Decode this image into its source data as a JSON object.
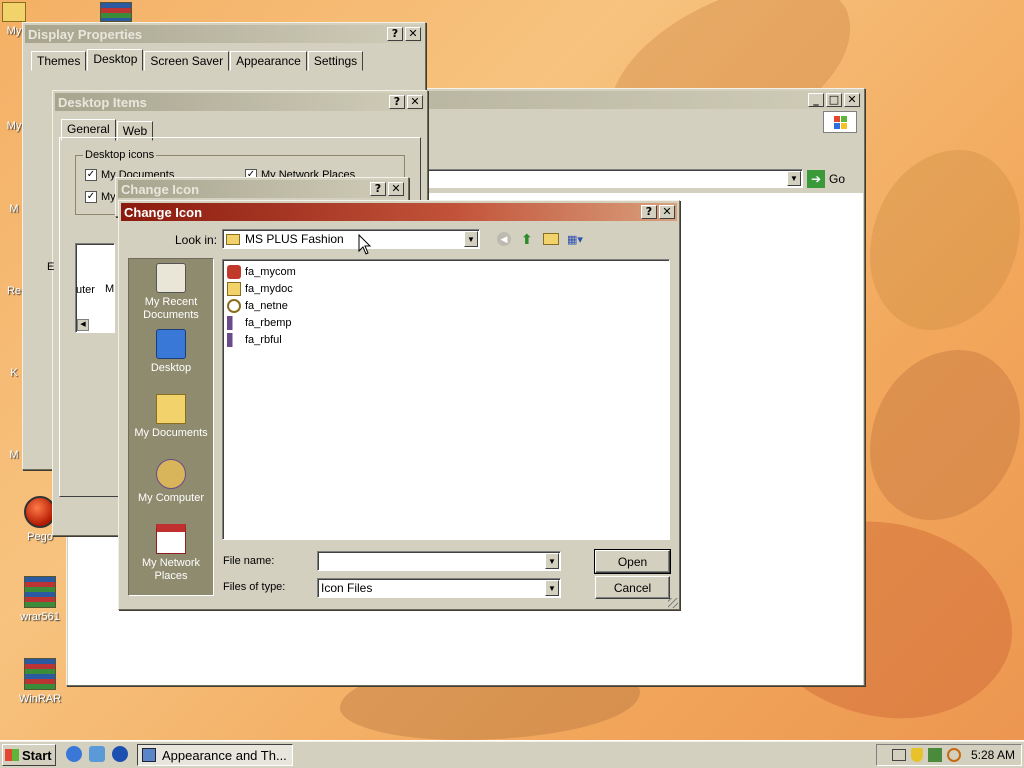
{
  "desktop": {
    "icons": [
      {
        "label": "My"
      },
      {
        "label": "My"
      },
      {
        "label": "M"
      },
      {
        "label": "Re"
      },
      {
        "label": "K"
      },
      {
        "label": "M"
      },
      {
        "label": "Pego"
      },
      {
        "label": "wrar561"
      },
      {
        "label": "WinRAR"
      }
    ]
  },
  "display_properties": {
    "title": "Display Properties",
    "tabs": [
      "Themes",
      "Desktop",
      "Screen Saver",
      "Appearance",
      "Settings"
    ]
  },
  "desktop_items": {
    "title": "Desktop Items",
    "tabs": [
      "General",
      "Web"
    ],
    "group_label": "Desktop icons",
    "checks": [
      "My Documents",
      "My Network Places",
      "My"
    ],
    "list_fragments": [
      "uter",
      "M"
    ],
    "label_e": "E"
  },
  "explorer": {
    "go_label": "Go"
  },
  "change_icon_bg": {
    "title": "Change Icon"
  },
  "change_icon": {
    "title": "Change Icon",
    "look_in_label": "Look in:",
    "look_in_value": "MS PLUS Fashion",
    "places": [
      "My Recent Documents",
      "Desktop",
      "My Documents",
      "My Computer",
      "My Network Places"
    ],
    "files": [
      {
        "name": "fa_mycom",
        "icon": "computer-icon"
      },
      {
        "name": "fa_mydoc",
        "icon": "folder-docs-icon"
      },
      {
        "name": "fa_netne",
        "icon": "network-icon"
      },
      {
        "name": "fa_rbemp",
        "icon": "recycle-bin-icon"
      },
      {
        "name": "fa_rbful",
        "icon": "recycle-bin-full-icon"
      }
    ],
    "file_name_label": "File name:",
    "file_name_value": "",
    "file_type_label": "Files of type:",
    "file_type_value": "Icon Files",
    "open_label": "Open",
    "cancel_label": "Cancel"
  },
  "taskbar": {
    "start_label": "Start",
    "task_label": "Appearance and Th...",
    "clock": "5:28 AM"
  }
}
